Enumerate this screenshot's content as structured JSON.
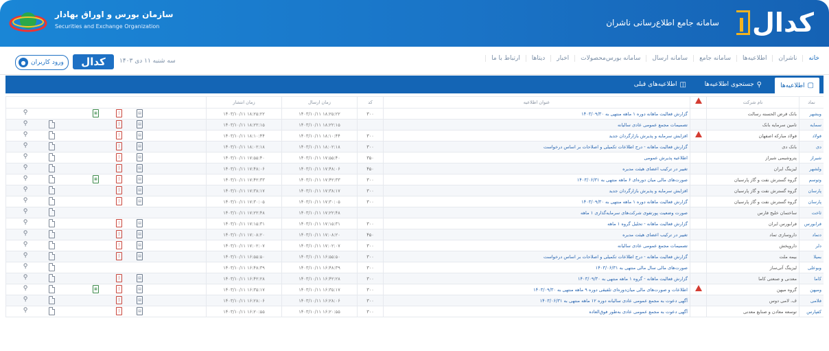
{
  "header": {
    "codal_word": "كدال",
    "system_title": "سامانه جامع اطلاع‌رسانی ناشران",
    "org_name_fa": "سازمان بورس و اوراق بهادار",
    "org_name_en": "Securities and Exchange Organization"
  },
  "nav": {
    "items": [
      "خانه",
      "ناشران",
      "اطلاعیه‌ها",
      "سامانه جامع",
      "سامانه ارسال",
      "سامانه بورس‌محصولات",
      "اخبار",
      "دیتاها",
      "ارتباط با ما"
    ],
    "date": "سه شنبه ۱۱ دی ۱۴۰۳",
    "codal_small": "كدال",
    "login_label": "ورود کاربران"
  },
  "tabs": {
    "announcements": "اطلاعیه‌ها",
    "search": "جستجوی اطلاعیه‌ها",
    "previous": "اطلاعیه‌های قبلی"
  },
  "table": {
    "headers": {
      "symbol": "نماد",
      "company": "نام شرکت",
      "title": "عنوان اطلاعیه",
      "code": "کد",
      "sent": "زمان ارسال",
      "published": "زمان انتشار"
    },
    "rows": [
      {
        "symbol": "وبشهر",
        "company": "بانک قرض الحسنه رسالت",
        "title": "گزارش فعالیت ماهانه دوره ۱ ماهه منتهی به ۱۴۰۳/۰۹/۳۰",
        "code": "۳۰۰",
        "sent": "۱۴۰۳/۱۰/۱۱ ۱۸:۲۵:۲۲",
        "published": "۱۴۰۳/۱۰/۱۱ ۱۸:۲۵:۲۲",
        "warn": false,
        "xls": true,
        "pdf": true,
        "doc": true,
        "att": false
      },
      {
        "symbol": "سمایه",
        "company": "تامین سرمایه بانک",
        "title": "تصمیمات مجمع عمومی عادی سالیانه",
        "code": "",
        "sent": "۱۴۰۳/۱۰/۱۱ ۱۸:۲۲:۱۵",
        "published": "۱۴۰۳/۱۰/۱۱ ۱۸:۲۲:۱۵",
        "warn": false,
        "xls": false,
        "pdf": true,
        "doc": true,
        "att": true
      },
      {
        "symbol": "فولاد",
        "company": "فولاد مبارکه اصفهان",
        "title": "افزایش سرمایه و پذیرش بازارگردان جدید",
        "code": "۳۰۰",
        "sent": "۱۴۰۳/۱۰/۱۱ ۱۸:۱۰:۴۴",
        "published": "۱۴۰۳/۱۰/۱۱ ۱۸:۱۰:۴۴",
        "warn": true,
        "xls": false,
        "pdf": true,
        "doc": true,
        "att": true
      },
      {
        "symbol": "دی",
        "company": "بانک دی",
        "title": "گزارش فعالیت ماهانه - درج اطلاعات تکمیلی و اصلاحات بر اساس درخواست",
        "code": "۳۰۰",
        "sent": "۱۴۰۳/۱۰/۱۱ ۱۸:۰۲:۱۸",
        "published": "۱۴۰۳/۱۰/۱۱ ۱۸:۰۲:۱۸",
        "warn": false,
        "xls": false,
        "pdf": true,
        "doc": true,
        "att": true
      },
      {
        "symbol": "شیراز",
        "company": "پتروشیمی شیراز",
        "title": "اطلاعیه پذیرش عمومی",
        "code": "۳۵۰",
        "sent": "۱۴۰۳/۱۰/۱۱ ۱۷:۵۵:۴۰",
        "published": "۱۴۰۳/۱۰/۱۱ ۱۷:۵۵:۴۰",
        "warn": false,
        "xls": false,
        "pdf": true,
        "doc": true,
        "att": true
      },
      {
        "symbol": "ولشهر",
        "company": "لیزینگ ایران",
        "title": "تغییر در ترکیب اعضای هیئت مدیره",
        "code": "۴۵۰",
        "sent": "۱۴۰۳/۱۰/۱۱ ۱۷:۴۸:۰۶",
        "published": "۱۴۰۳/۱۰/۱۱ ۱۷:۴۸:۰۶",
        "warn": false,
        "xls": false,
        "pdf": true,
        "doc": true,
        "att": true
      },
      {
        "symbol": "وتوسم",
        "company": "گروه گسترش نفت و گاز پارسیان",
        "title": "صورت‌های مالی میان دوره‌ای ۶ ماهه منتهی به ۱۴۰۳/۰۶/۳۱",
        "code": "۳۰۰",
        "sent": "۱۴۰۳/۱۰/۱۱ ۱۷:۴۲:۳۳",
        "published": "۱۴۰۳/۱۰/۱۱ ۱۷:۴۲:۳۳",
        "warn": false,
        "xls": true,
        "pdf": true,
        "doc": true,
        "att": true
      },
      {
        "symbol": "پارسان",
        "company": "گروه گسترش نفت و گاز پارسیان",
        "title": "افزایش سرمایه و پذیرش بازارگردان جدید",
        "code": "۳۰۰",
        "sent": "۱۴۰۳/۱۰/۱۱ ۱۷:۳۸:۱۷",
        "published": "۱۴۰۳/۱۰/۱۱ ۱۷:۳۸:۱۷",
        "warn": false,
        "xls": false,
        "pdf": true,
        "doc": true,
        "att": true
      },
      {
        "symbol": "پارسان",
        "company": "گروه گسترش نفت و گاز پارسیان",
        "title": "گزارش فعالیت ماهانه دوره ۱ ماهه منتهی به ۱۴۰۳/۰۹/۳۰",
        "code": "۳۰۰",
        "sent": "۱۴۰۳/۱۰/۱۱ ۱۷:۳۰:۰۵",
        "published": "۱۴۰۳/۱۰/۱۱ ۱۷:۳۰:۰۵",
        "warn": false,
        "xls": false,
        "pdf": true,
        "doc": true,
        "att": true
      },
      {
        "symbol": "ثاخت",
        "company": "ساختمان خلیج فارس",
        "title": "صورت وضعیت پورتفوی شرکت‌های سرمایه‌گذاری ۱ ماهه",
        "code": "",
        "sent": "۱۴۰۳/۱۰/۱۱ ۱۷:۲۲:۴۸",
        "published": "۱۴۰۳/۱۰/۱۱ ۱۷:۲۲:۴۸",
        "warn": false,
        "xls": false,
        "pdf": false,
        "doc": false,
        "att": true
      },
      {
        "symbol": "فرابورس",
        "company": "فرابورس ایران",
        "title": "گزارش فعالیت ماهانه - تحلیل گروه ۱ ماهه",
        "code": "۳۰۰",
        "sent": "۱۴۰۳/۱۰/۱۱ ۱۷:۱۵:۳۱",
        "published": "۱۴۰۳/۱۰/۱۱ ۱۷:۱۵:۳۱",
        "warn": false,
        "xls": false,
        "pdf": true,
        "doc": true,
        "att": true
      },
      {
        "symbol": "دتماد",
        "company": "داروسازی تماد",
        "title": "تغییر در ترکیب اعضای هیئت مدیره",
        "code": "۴۵۰",
        "sent": "۱۴۰۳/۱۰/۱۱ ۱۷:۰۸:۲۰",
        "published": "۱۴۰۳/۱۰/۱۱ ۱۷:۰۸:۲۰",
        "warn": false,
        "xls": false,
        "pdf": true,
        "doc": true,
        "att": true
      },
      {
        "symbol": "دلر",
        "company": "داروپخش",
        "title": "تصمیمات مجمع عمومی عادی سالیانه",
        "code": "۳۰۰",
        "sent": "۱۴۰۳/۱۰/۱۱ ۱۷:۰۲:۰۷",
        "published": "۱۴۰۳/۱۰/۱۱ ۱۷:۰۲:۰۷",
        "warn": false,
        "xls": false,
        "pdf": true,
        "doc": true,
        "att": true
      },
      {
        "symbol": "بمیلا",
        "company": "بیمه ملت",
        "title": "گزارش فعالیت ماهانه - درج اطلاعات تکمیلی و اصلاحات بر اساس درخواست",
        "code": "۳۰۰",
        "sent": "۱۴۰۳/۱۰/۱۱ ۱۶:۵۵:۵۰",
        "published": "۱۴۰۳/۱۰/۱۱ ۱۶:۵۵:۵۰",
        "warn": false,
        "xls": false,
        "pdf": true,
        "doc": true,
        "att": true
      },
      {
        "symbol": "وبوعلی",
        "company": "لیزینگ آتی‌ساز",
        "title": "صورت‌های مالی سال مالی منتهی به ۱۴۰۳/۰۶/۳۱",
        "code": "۳۰۰",
        "sent": "۱۴۰۳/۱۰/۱۱ ۱۶:۴۸:۳۹",
        "published": "۱۴۰۳/۱۰/۱۱ ۱۶:۴۸:۳۹",
        "warn": false,
        "xls": false,
        "pdf": false,
        "doc": false,
        "att": true
      },
      {
        "symbol": "کاما",
        "company": "معدنی و صنعتی کاما",
        "title": "گزارش فعالیت ماهانه - گروه ۱ ماهه منتهی به ۱۴۰۳/۰۹/۳۰",
        "code": "۳۰۰",
        "sent": "۱۴۰۳/۱۰/۱۱ ۱۶:۴۲:۲۸",
        "published": "۱۴۰۳/۱۰/۱۱ ۱۶:۴۲:۲۸",
        "warn": false,
        "xls": false,
        "pdf": true,
        "doc": true,
        "att": true
      },
      {
        "symbol": "ومیهن",
        "company": "گروه میهن",
        "title": "اطلاعات و صورت‌های مالی میان‌دوره‌ای تلفیقی دوره ۹ ماهه منتهی به ۱۴۰۳/۰۹/۳۰",
        "code": "۳۰۰",
        "sent": "۱۴۰۳/۱۰/۱۱ ۱۶:۳۵:۱۷",
        "published": "۱۴۰۳/۱۰/۱۱ ۱۶:۳۵:۱۷",
        "warn": true,
        "xls": true,
        "pdf": true,
        "doc": true,
        "att": true
      },
      {
        "symbol": "فلامی",
        "company": "ف. لامی دوس",
        "title": "آگهی دعوت به مجمع عمومی عادی سالیانه دوره ۱۲ ماهه منتهی به ۱۴۰۳/۰۶/۳۱",
        "code": "۳۰۰",
        "sent": "۱۴۰۳/۱۰/۱۱ ۱۶:۲۸:۰۶",
        "published": "۱۴۰۳/۱۰/۱۱ ۱۶:۲۸:۰۶",
        "warn": false,
        "xls": false,
        "pdf": true,
        "doc": true,
        "att": true
      },
      {
        "symbol": "کفپارس",
        "company": "توسعه معادن و صنایع معدنی",
        "title": "آگهی دعوت به مجمع عمومی عادی به‌طور فوق‌العاده",
        "code": "۳۰۰",
        "sent": "۱۴۰۳/۱۰/۱۱ ۱۶:۲۰:۵۵",
        "published": "۱۴۰۳/۱۰/۱۱ ۱۶:۲۰:۵۵",
        "warn": false,
        "xls": false,
        "pdf": true,
        "doc": true,
        "att": true
      }
    ]
  },
  "colors": {
    "brand_blue": "#1465b5",
    "banner_blue": "#1a86d6",
    "accent_gold": "#f3b31f",
    "warn_red": "#d43c32"
  }
}
